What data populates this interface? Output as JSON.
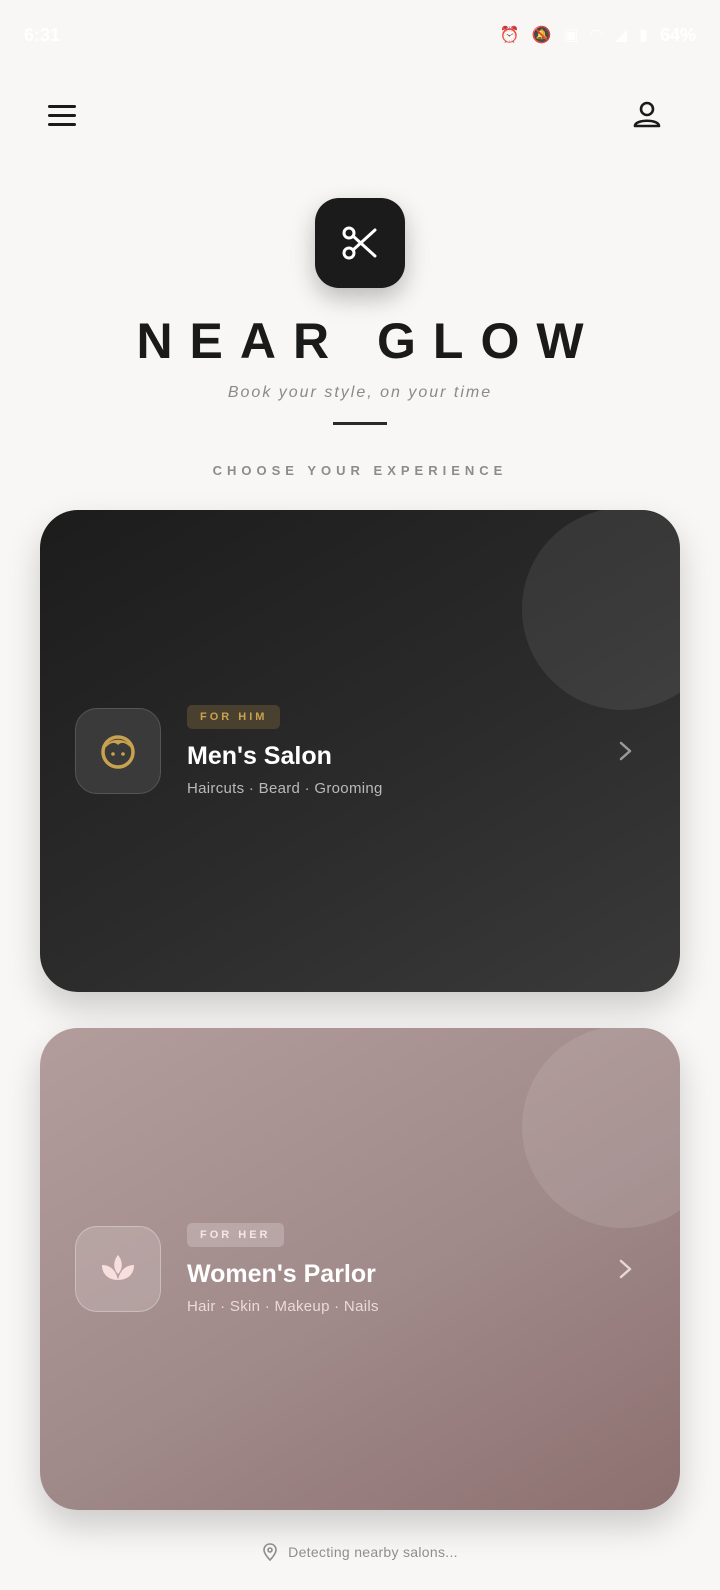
{
  "status_bar": {
    "time": "6:31",
    "battery": "64%",
    "icons": [
      "alarm-icon",
      "mute-icon",
      "no-sim-icon",
      "wifi-icon",
      "signal-icon",
      "battery-icon"
    ]
  },
  "header": {
    "menu_icon": "hamburger-menu-icon",
    "profile_icon": "person-icon"
  },
  "brand": {
    "logo_icon": "scissors-icon",
    "name": "NEAR GLOW",
    "tagline": "Book your style, on your time"
  },
  "section_label": "CHOOSE YOUR EXPERIENCE",
  "cards": [
    {
      "tag": "FOR HIM",
      "title": "Men's Salon",
      "subtitle": "Haircuts · Beard · Grooming",
      "icon": "face-icon",
      "accent": "#c9a24f"
    },
    {
      "tag": "FOR HER",
      "title": "Women's Parlor",
      "subtitle": "Hair · Skin · Makeup · Nails",
      "icon": "lotus-icon",
      "accent": "#f7dada"
    }
  ],
  "footer": {
    "icon": "location-pin-icon",
    "text": "Detecting nearby salons..."
  },
  "colors": {
    "background": "#f8f7f5",
    "men_card": "#2a2a2a",
    "women_card": "#a08989",
    "gold": "#c9a24f"
  }
}
